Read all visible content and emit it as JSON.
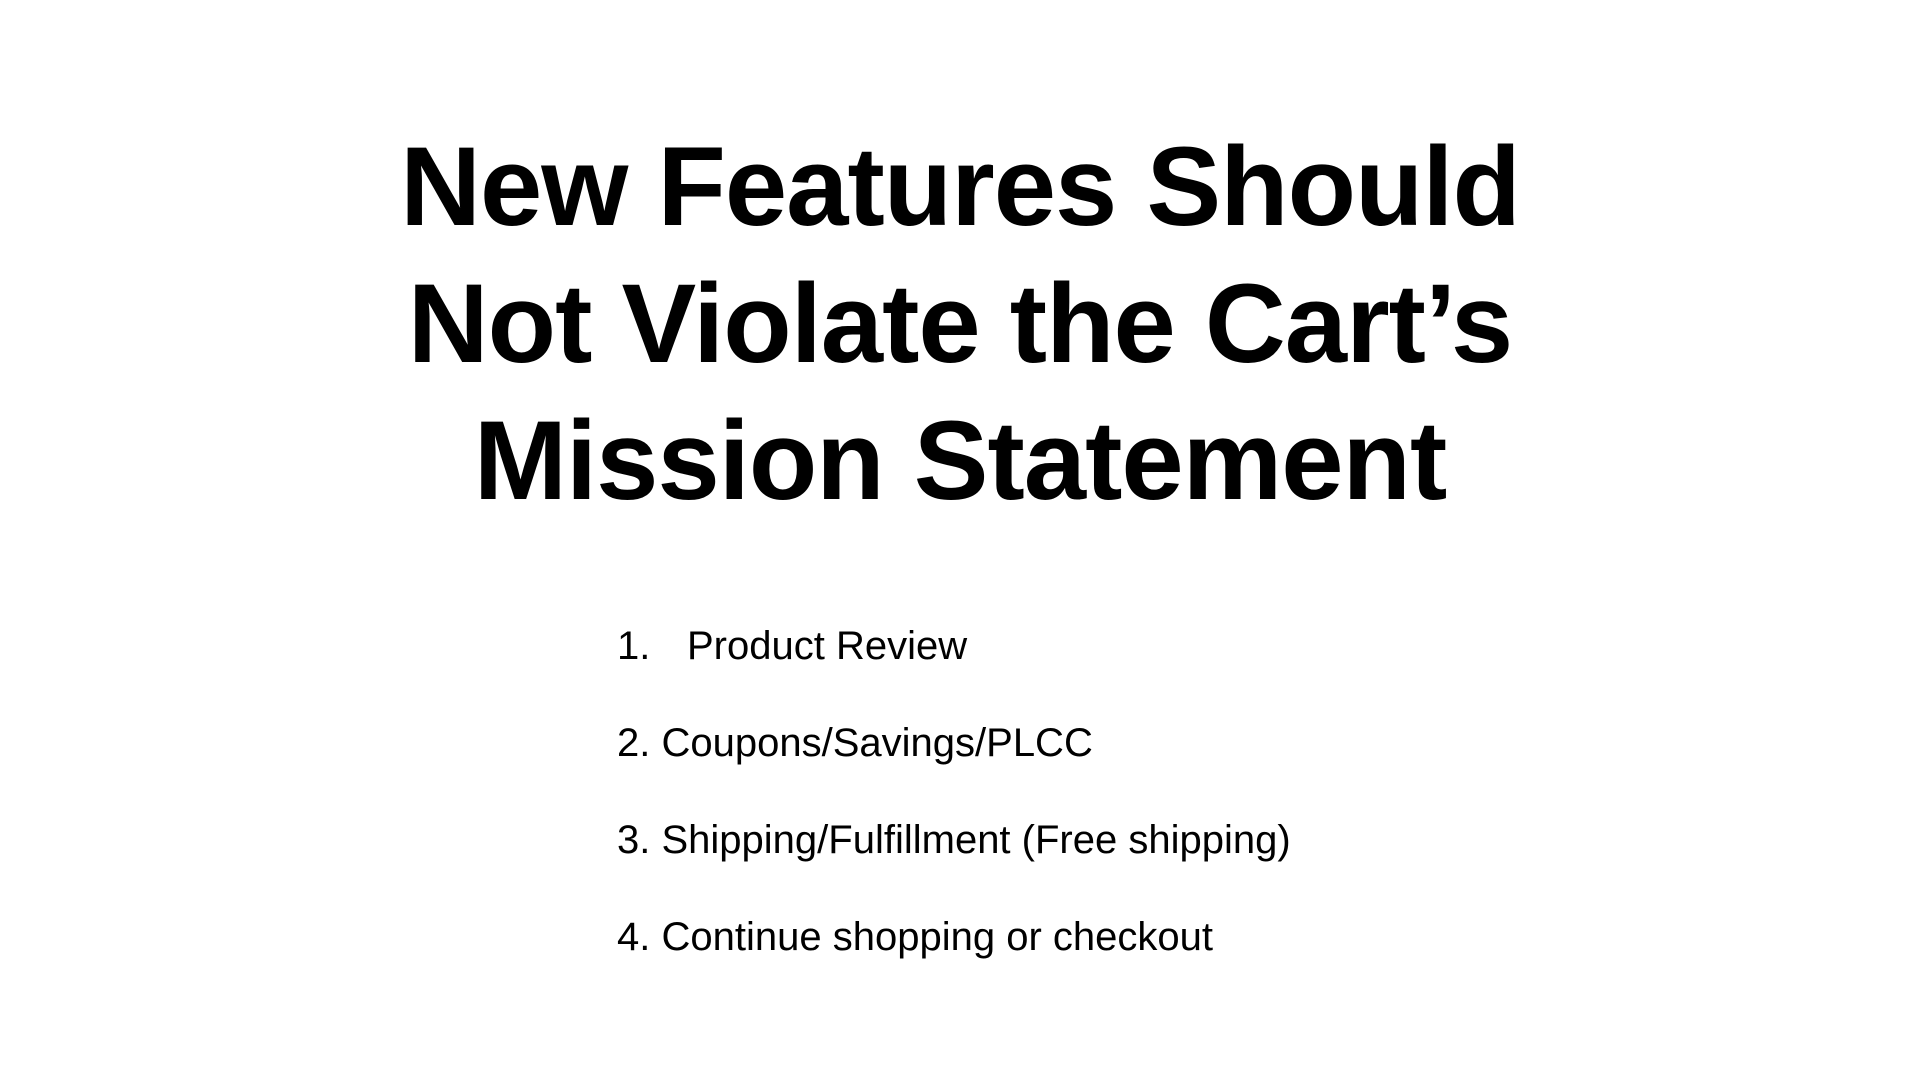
{
  "slide": {
    "title_lines": [
      "New Features Should",
      "Not Violate the Cart’s",
      "Mission Statement"
    ],
    "items": [
      {
        "number": "1.",
        "text": "Product Review"
      },
      {
        "number": "2.",
        "text": "Coupons/Savings/PLCC"
      },
      {
        "number": "3.",
        "text": "Shipping/Fulfillment (Free shipping)"
      },
      {
        "number": "4.",
        "text": "Continue shopping or checkout"
      }
    ]
  }
}
